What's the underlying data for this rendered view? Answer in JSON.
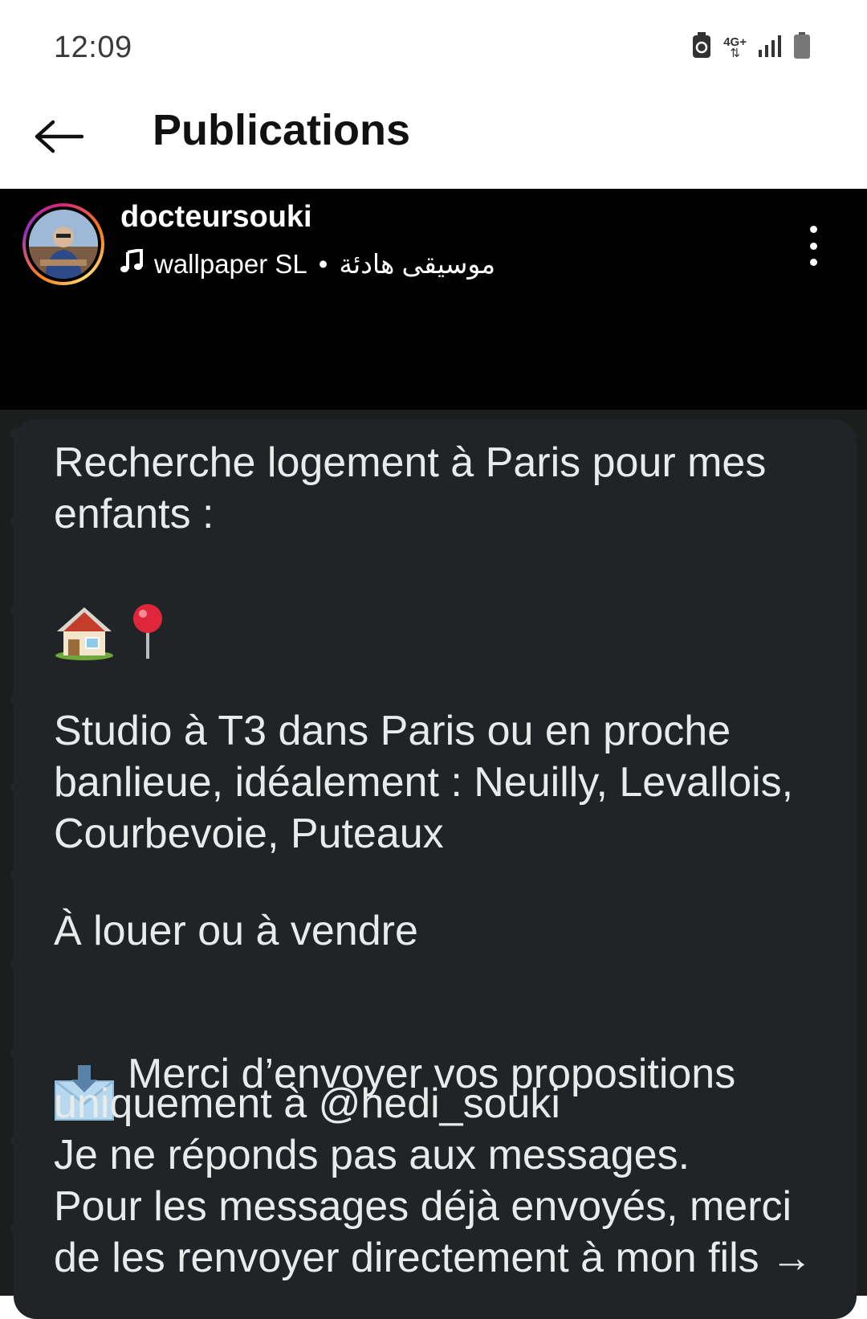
{
  "status_bar": {
    "time": "12:09",
    "network": "4G+",
    "icons": [
      "data-saver-icon",
      "network-4g-icon",
      "signal-icon",
      "battery-icon"
    ]
  },
  "app_bar": {
    "back_icon": "arrow-left-icon",
    "title": "Publications"
  },
  "post": {
    "username": "docteursouki",
    "music_icon": "music-note-icon",
    "music_artist": "wallpaper SL",
    "separator": "•",
    "music_title": "موسيقى هادئة",
    "more_icon": "more-vertical-icon"
  },
  "message": {
    "line1": "Recherche logement à Paris pour mes\nenfants :",
    "emojis": [
      "house-emoji",
      "pin-emoji"
    ],
    "paragraph2": "Studio à T3 dans Paris ou en proche\nbanlieue, idéalement :  Neuilly, Levallois,\nCourbevoie, Puteaux",
    "paragraph3": "À louer ou à vendre",
    "paragraph4_first": "Merci d’envoyer vos propositions",
    "paragraph4_rest": "uniquement à @hedi_souki\nJe ne réponds pas aux messages.\nPour les messages déjà envoyés, merci\nde les renvoyer directement à mon fils →"
  },
  "colors": {
    "header_bg": "#000000",
    "bubble_bg": "#212426",
    "text_light": "#e9eaea"
  }
}
